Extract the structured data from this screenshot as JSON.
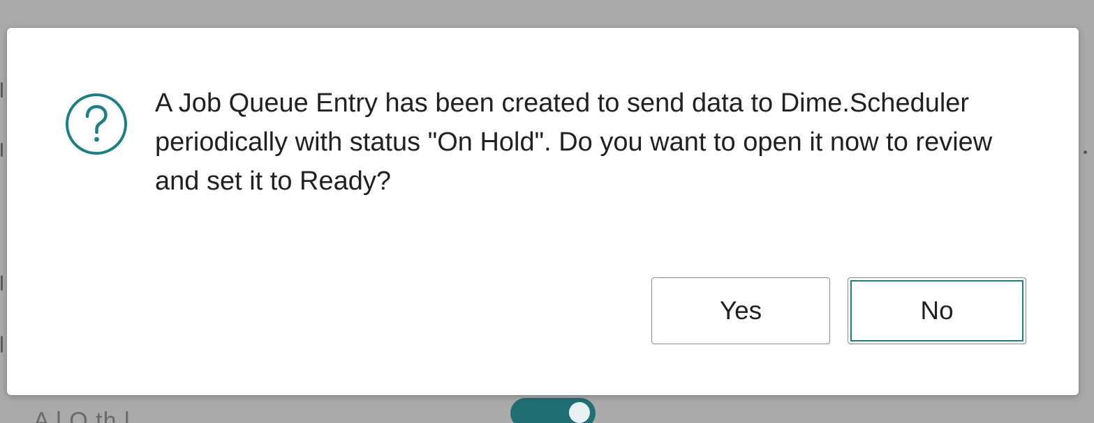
{
  "dialog": {
    "icon": "question-circle-icon",
    "message": "A Job Queue Entry has been created to send data to Dime.Scheduler periodically with status \"On Hold\". Do you want to open it now to review and set it to Ready?",
    "buttons": {
      "yes_label": "Yes",
      "no_label": "No"
    },
    "focused_button": "No"
  },
  "background": {
    "text_fragment": "A    l           O  th     l",
    "toggle_state": "on"
  },
  "colors": {
    "accent": "#1a7f86",
    "icon": "#1a7f86",
    "text": "#212121",
    "overlay": "#b9b9b9"
  }
}
